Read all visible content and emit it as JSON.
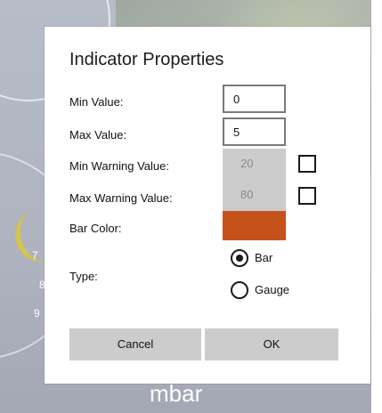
{
  "background": {
    "gauge_numbers": [
      "7",
      "8",
      "9"
    ],
    "label": "mbar"
  },
  "dialog": {
    "title": "Indicator Properties",
    "min_value": {
      "label": "Min Value:",
      "value": "0"
    },
    "max_value": {
      "label": "Max Value:",
      "value": "5"
    },
    "min_warning": {
      "label": "Min Warning Value:",
      "value": "20",
      "checked": false
    },
    "max_warning": {
      "label": "Max Warning Value:",
      "value": "80",
      "checked": false
    },
    "bar_color": {
      "label": "Bar Color:",
      "color": "#c6521b"
    },
    "type": {
      "label": "Type:",
      "options": [
        {
          "label": "Bar",
          "selected": true
        },
        {
          "label": "Gauge",
          "selected": false
        }
      ]
    },
    "buttons": {
      "cancel": "Cancel",
      "ok": "OK"
    }
  },
  "colors": {
    "button_bg": "#cccccc",
    "disabled_field_bg": "#cccccc"
  }
}
